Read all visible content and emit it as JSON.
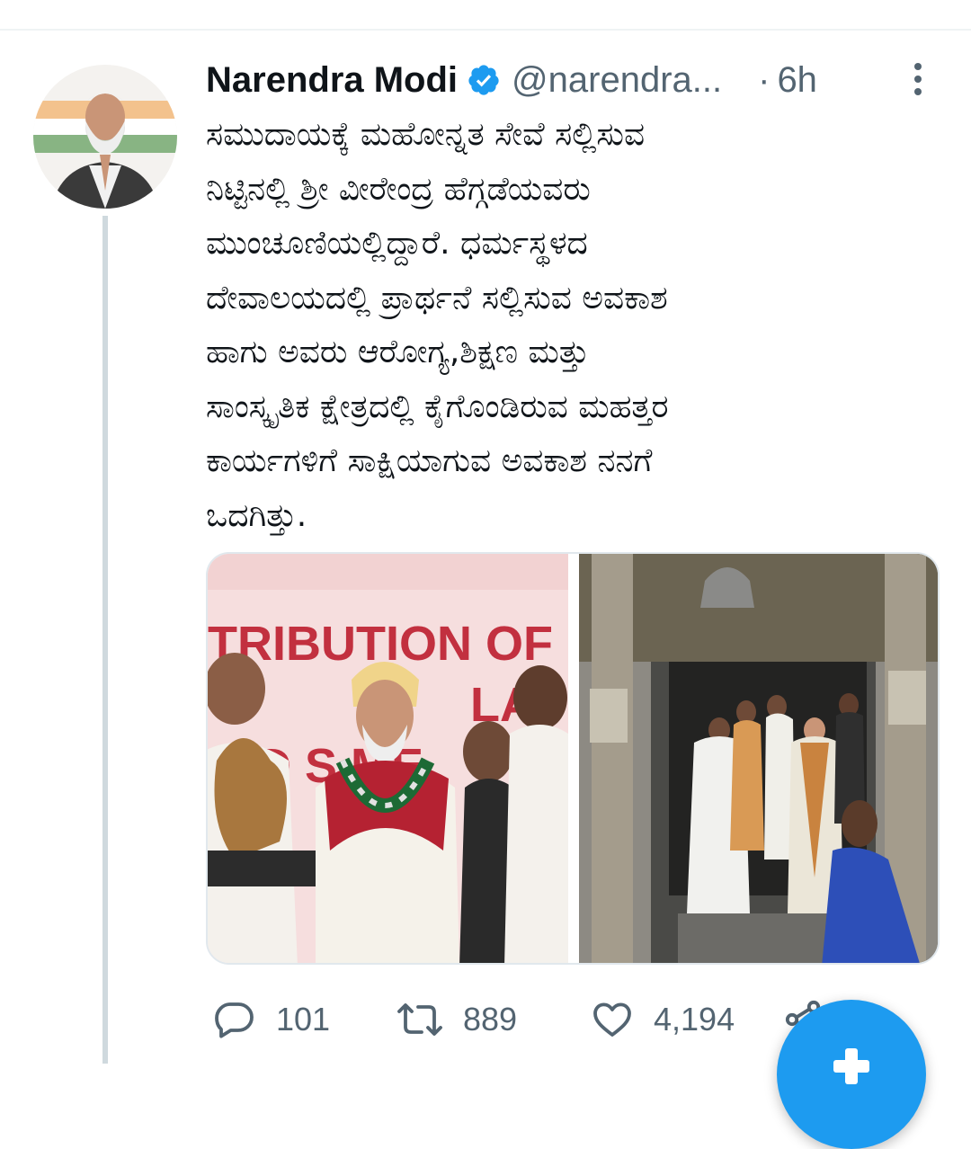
{
  "colors": {
    "accent": "#1d9bf0",
    "text_primary": "#0f1419",
    "text_secondary": "#536471",
    "thread_line": "#cfd9de"
  },
  "tweet": {
    "author": {
      "display_name": "Narendra Modi",
      "handle": "@narendra...",
      "verified": true,
      "avatar_icon": "avatar-photo"
    },
    "time_separator": "·",
    "timestamp": "6h",
    "text_lines": [
      "ಸಮುದಾಯಕ್ಕೆ ಮಹೋನ್ನತ ಸೇವೆ ಸಲ್ಲಿಸುವ",
      "ನಿಟ್ಟಿನಲ್ಲಿ ಶ್ರೀ ವೀರೇಂದ್ರ ಹೆಗ್ಗಡೆಯವರು",
      "ಮುಂಚೂಣಿಯಲ್ಲಿದ್ದಾರೆ. ಧರ್ಮಸ್ಥಳದ",
      "ದೇವಾಲಯದಲ್ಲಿ ಪ್ರಾರ್ಥನೆ ಸಲ್ಲಿಸುವ ಅವಕಾಶ",
      "ಹಾಗು ಅವರು ಆರೋಗ್ಯ,ಶಿಕ್ಷಣ ಮತ್ತು",
      "ಸಾಂಸ್ಕೃತಿಕ ಕ್ಷೇತ್ರದಲ್ಲಿ ಕೈಗೊಂಡಿರುವ ಮಹತ್ತರ",
      "ಕಾರ್ಯಗಳಿಗೆ  ಸಾಕ್ಷಿಯಾಗುವ ಅವಕಾಶ ನನಗೆ",
      "ಒದಗಿತ್ತು."
    ],
    "media": {
      "photo_1_banner": "TRIBUTION OF 1",
      "photo_1_banner_line2": "LA",
      "photo_1_banner_line3": "D S   ME",
      "photo_2_icon": "temple-photo"
    },
    "actions": {
      "reply": {
        "icon": "reply-icon",
        "count": "101"
      },
      "retweet": {
        "icon": "retweet-icon",
        "count": "889"
      },
      "like": {
        "icon": "heart-icon",
        "count": "4,194"
      },
      "share": {
        "icon": "share-icon"
      }
    }
  },
  "compose_fab": {
    "icon": "plus-icon"
  }
}
